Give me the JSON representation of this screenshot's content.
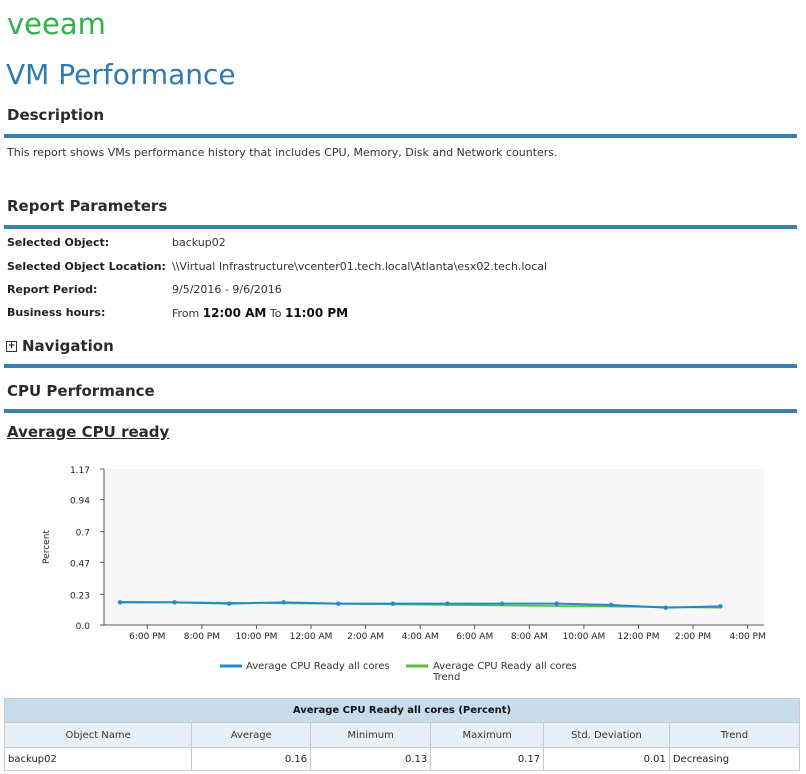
{
  "brand": {
    "logo_text": "veeam",
    "color": "#32b04a"
  },
  "page_title": "VM Performance",
  "description": {
    "heading": "Description",
    "text": "This report shows VMs performance history that includes CPU, Memory, Disk and Network counters."
  },
  "parameters": {
    "heading": "Report Parameters",
    "selected_object_label": "Selected Object:",
    "selected_object_value": "backup02",
    "location_label": "Selected Object Location:",
    "location_value": "\\\\Virtual Infrastructure\\vcenter01.tech.local\\Atlanta\\esx02.tech.local",
    "period_label": "Report Period:",
    "period_value": "9/5/2016 - 9/6/2016",
    "business_label": "Business hours:",
    "business_from": "From",
    "business_start": "12:00 AM",
    "business_to": "To",
    "business_end": "11:00 PM"
  },
  "navigation": {
    "label": "Navigation",
    "expand_symbol": "+"
  },
  "cpu_section": {
    "heading": "CPU Performance"
  },
  "chart_title": "Average CPU ready",
  "chart_data": {
    "type": "line",
    "ylabel": "Percent",
    "xlabel": "",
    "yticks": [
      "1.17",
      "0.94",
      "0.7",
      "0.47",
      "0.23",
      "0.0"
    ],
    "ylim": [
      0,
      1.17
    ],
    "xticks": [
      "6:00 PM",
      "8:00 PM",
      "10:00 PM",
      "12:00 AM",
      "2:00 AM",
      "4:00 AM",
      "6:00 AM",
      "8:00 AM",
      "10:00 AM",
      "12:00 PM",
      "2:00 PM",
      "4:00 PM"
    ],
    "grid": false,
    "series": [
      {
        "name": "Average CPU Ready all cores",
        "color": "#1f8bc9",
        "x": [
          "5:00 PM",
          "7:00 PM",
          "9:00 PM",
          "11:00 PM",
          "1:00 AM",
          "3:00 AM",
          "5:00 AM",
          "7:00 AM",
          "9:00 AM",
          "11:00 AM",
          "1:00 PM",
          "3:00 PM"
        ],
        "values": [
          0.17,
          0.17,
          0.16,
          0.17,
          0.16,
          0.16,
          0.16,
          0.16,
          0.16,
          0.15,
          0.13,
          0.14
        ]
      },
      {
        "name": "Average CPU Ready all cores Trend",
        "color": "#5cbf3a",
        "x": [
          "5:00 PM",
          "3:00 PM"
        ],
        "values": [
          0.175,
          0.13
        ]
      }
    ],
    "legend": [
      "Average CPU Ready all cores",
      "Average CPU Ready all cores Trend"
    ],
    "legend_lines": [
      [
        "Average CPU Ready all cores"
      ],
      [
        "Average CPU Ready all cores",
        "Trend"
      ]
    ],
    "legend_placement": "bottom"
  },
  "table": {
    "caption": "Average CPU Ready all cores (Percent)",
    "columns": [
      "Object Name",
      "Average",
      "Minimum",
      "Maximum",
      "Std. Deviation",
      "Trend"
    ],
    "rows": [
      [
        "backup02",
        "0.16",
        "0.13",
        "0.17",
        "0.01",
        "Decreasing"
      ]
    ]
  }
}
